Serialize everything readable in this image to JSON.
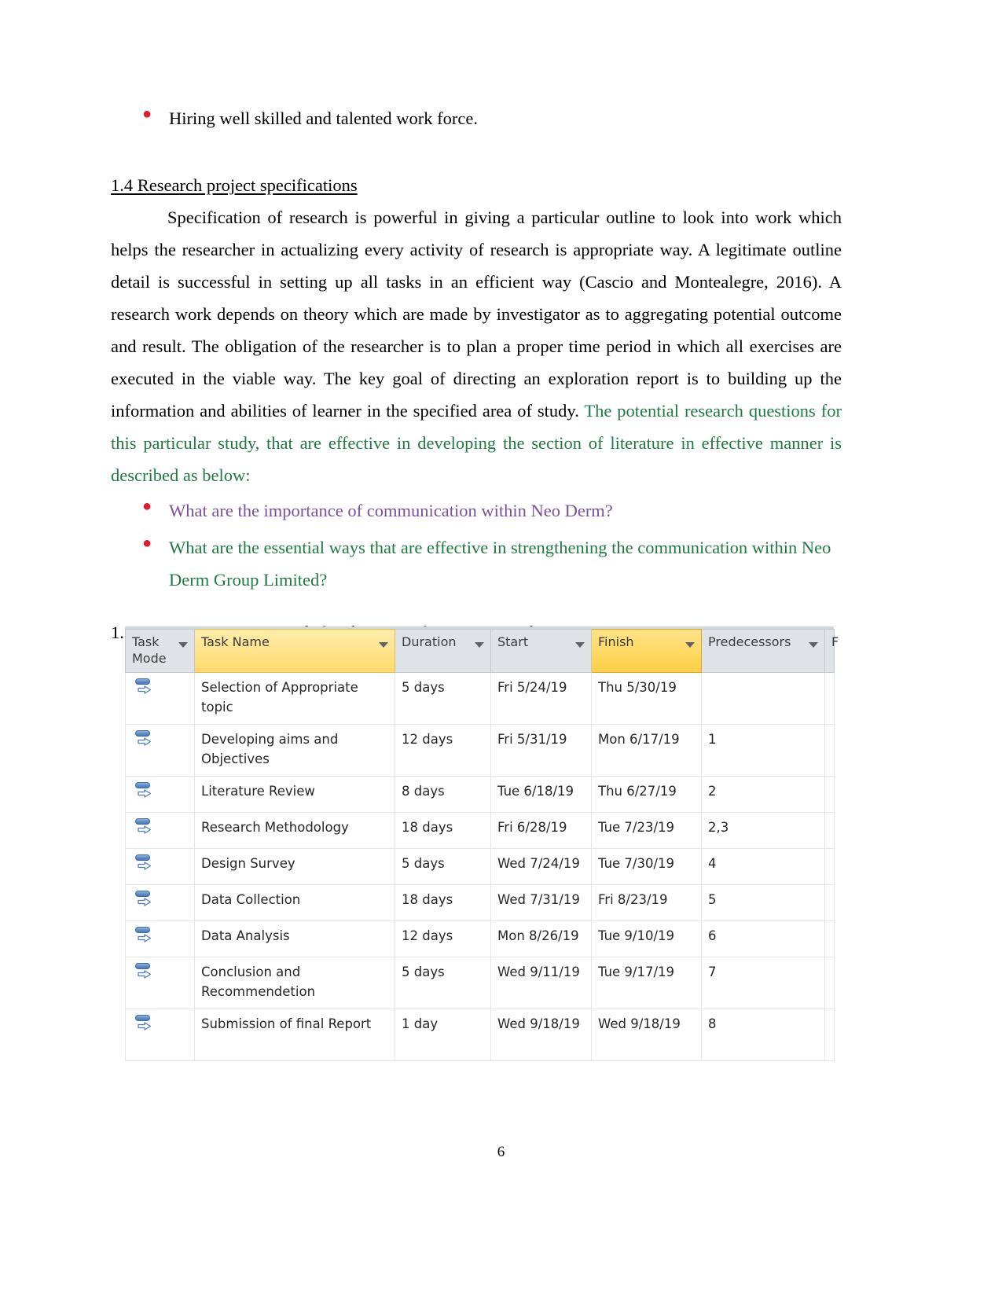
{
  "document": {
    "page_number": "6",
    "intro_bullet": "Hiring well skilled and talented work force.",
    "section_1_4": {
      "heading": "1.4 Research project specifications",
      "paragraph_black": "Specification of research is powerful in giving a particular outline to look into work which helps the researcher in actualizing every activity of research is appropriate way. A legitimate outline detail is successful in setting up all tasks in an efficient way (Cascio and Montealegre, 2016). A research work depends on theory which are made by investigator as to aggregating potential outcome and result. The obligation of the researcher is to plan a proper time period in which all exercises are executed in the viable way. The key goal of directing an exploration report is to building up the information and abilities of learner in the specified area of study.",
      "paragraph_green": " The potential research questions for this particular study, that are effective in developing the section of literature in effective manner is described as below:",
      "questions": [
        {
          "text": "What are the importance of communication within Neo Derm?",
          "color": "#7b4f9d"
        },
        {
          "text": "What are the essential ways that are effective in strengthening the communication within Neo Derm Group Limited?",
          "color": "#1f7a42"
        }
      ]
    },
    "section_1_5": {
      "heading": "1.5 Appropriate process and plan for research project specifications."
    }
  },
  "colors": {
    "bullet_red": "#e8192c",
    "green_text": "#1f7a42",
    "purple_text": "#7b4f9d",
    "header_grey": "#dfe3e8",
    "header_highlight": "#ffd75e"
  },
  "gantt_table": {
    "columns": [
      {
        "label": "Task Mode",
        "highlight": "none",
        "has_caret": true
      },
      {
        "label": "Task Name",
        "highlight": "light",
        "has_caret": true
      },
      {
        "label": "Duration",
        "highlight": "none",
        "has_caret": true
      },
      {
        "label": "Start",
        "highlight": "none",
        "has_caret": true
      },
      {
        "label": "Finish",
        "highlight": "full",
        "has_caret": true
      },
      {
        "label": "Predecessors",
        "highlight": "none",
        "has_caret": true
      },
      {
        "label": "F",
        "highlight": "none",
        "has_caret": false
      }
    ],
    "rows": [
      {
        "mode_icon": "auto-scheduled-icon",
        "name": "Selection of Appropriate topic",
        "duration": "5 days",
        "start": "Fri 5/24/19",
        "finish": "Thu 5/30/19",
        "predecessors": ""
      },
      {
        "mode_icon": "auto-scheduled-icon",
        "name": "Developing aims and Objectives",
        "duration": "12 days",
        "start": "Fri 5/31/19",
        "finish": "Mon 6/17/19",
        "predecessors": "1"
      },
      {
        "mode_icon": "auto-scheduled-icon",
        "name": "Literature Review",
        "duration": "8 days",
        "start": "Tue 6/18/19",
        "finish": "Thu 6/27/19",
        "predecessors": "2"
      },
      {
        "mode_icon": "auto-scheduled-icon",
        "name": "Research Methodology",
        "duration": "18 days",
        "start": "Fri 6/28/19",
        "finish": "Tue 7/23/19",
        "predecessors": "2,3"
      },
      {
        "mode_icon": "auto-scheduled-icon",
        "name": "Design Survey",
        "duration": "5 days",
        "start": "Wed 7/24/19",
        "finish": "Tue 7/30/19",
        "predecessors": "4"
      },
      {
        "mode_icon": "auto-scheduled-icon",
        "name": "Data Collection",
        "duration": "18 days",
        "start": "Wed 7/31/19",
        "finish": "Fri 8/23/19",
        "predecessors": "5"
      },
      {
        "mode_icon": "auto-scheduled-icon",
        "name": "Data Analysis",
        "duration": "12 days",
        "start": "Mon 8/26/19",
        "finish": "Tue 9/10/19",
        "predecessors": "6"
      },
      {
        "mode_icon": "auto-scheduled-icon",
        "name": "Conclusion and Recommendetion",
        "duration": "5 days",
        "start": "Wed 9/11/19",
        "finish": "Tue 9/17/19",
        "predecessors": "7"
      },
      {
        "mode_icon": "auto-scheduled-icon",
        "name": "Submission of final Report",
        "duration": "1 day",
        "start": "Wed 9/18/19",
        "finish": "Wed 9/18/19",
        "predecessors": "8"
      }
    ]
  }
}
